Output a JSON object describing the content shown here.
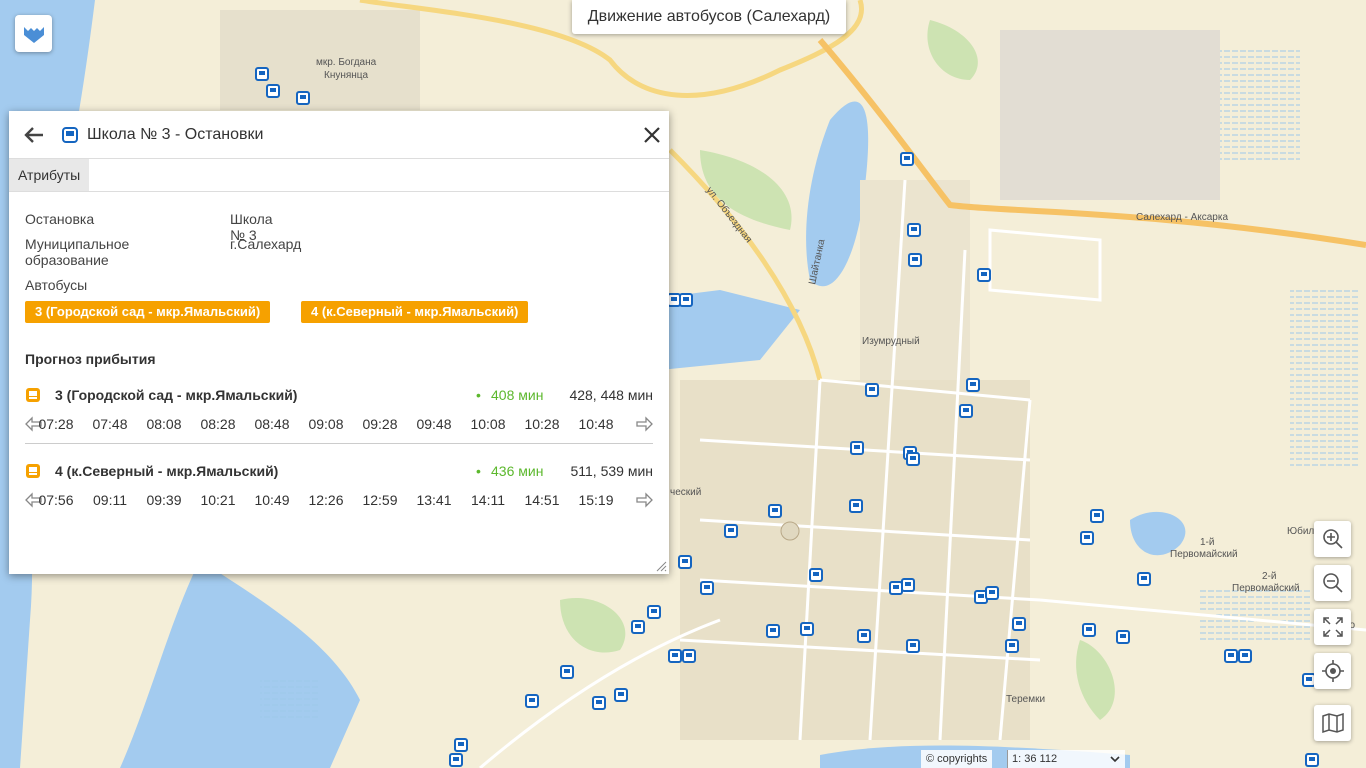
{
  "app": {
    "map_title": "Движение автобусов (Салехард)"
  },
  "map": {
    "labels": {
      "bogdana": "мкр. Богдана",
      "knunyanca": "Кнунянца",
      "obezdnaya": "ул. Объездная",
      "shaitanka": "Шайтанка",
      "izumrudny": "Изумрудный",
      "salekhard_aksarka": "Салехард - Аксарка",
      "pervomaisky1a": "1-й",
      "pervomaisky1b": "Первомайский",
      "pervomaisky2a": "2-й",
      "pervomaisky2b": "Первомайский",
      "yubil": "Юбил",
      "perv_edge": "Перво",
      "teremki": "Теремки",
      "cheskiy": "ческий"
    },
    "copyright": "© copyrights",
    "scale": "1: 36 112"
  },
  "panel": {
    "title": "Школа № 3 - Остановки",
    "tab": "Атрибуты",
    "attributes": [
      {
        "label": "Остановка",
        "value": "Школа № 3"
      },
      {
        "label": "Муниципальное образование",
        "value": "г.Салехард"
      },
      {
        "label": "Автобусы",
        "value": ""
      }
    ],
    "routes": [
      "3 (Городской сад - мкр.Ямальский)",
      "4 (к.Северный - мкр.Ямальский)"
    ],
    "forecast_title": "Прогноз прибытия",
    "forecast": [
      {
        "name": "3 (Городской сад - мкр.Ямальский)",
        "bullet": "•",
        "next": "408 мин",
        "more": "428, 448 мин",
        "times": [
          "07:28",
          "07:48",
          "08:08",
          "08:28",
          "08:48",
          "09:08",
          "09:28",
          "09:48",
          "10:08",
          "10:28",
          "10:48"
        ]
      },
      {
        "name": "4 (к.Северный - мкр.Ямальский)",
        "bullet": "•",
        "next": "436 мин",
        "more": "511, 539 мин",
        "times": [
          "07:56",
          "09:11",
          "09:39",
          "10:21",
          "10:49",
          "12:26",
          "12:59",
          "13:41",
          "14:11",
          "14:51",
          "15:19"
        ]
      }
    ]
  },
  "icons": {
    "back": "arrow-left-icon",
    "bus": "bus-icon",
    "close": "close-icon",
    "zoom_in": "zoom-in-icon",
    "zoom_out": "zoom-out-icon",
    "fullscreen": "fullscreen-icon",
    "locate": "locate-icon",
    "basemap": "basemap-icon"
  },
  "colors": {
    "route_tag": "#f6a100",
    "next_arrival": "#5cb82d",
    "water": "#a3cbef",
    "bus_stop": "#1565c0"
  }
}
